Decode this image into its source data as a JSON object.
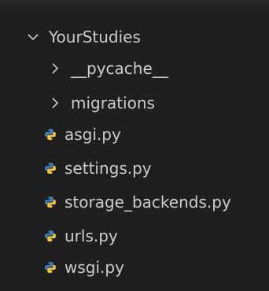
{
  "explorer": {
    "root_folder": {
      "label": "YourStudies",
      "icon": "chevron-down-icon",
      "expanded": true
    },
    "items": [
      {
        "label": "__pycache__",
        "type": "folder",
        "icon": "chevron-right-icon"
      },
      {
        "label": "migrations",
        "type": "folder",
        "icon": "chevron-right-icon"
      },
      {
        "label": "asgi.py",
        "type": "file",
        "icon": "python-file-icon"
      },
      {
        "label": "settings.py",
        "type": "file",
        "icon": "python-file-icon"
      },
      {
        "label": "storage_backends.py",
        "type": "file",
        "icon": "python-file-icon"
      },
      {
        "label": "urls.py",
        "type": "file",
        "icon": "python-file-icon"
      },
      {
        "label": "wsgi.py",
        "type": "file",
        "icon": "python-file-icon"
      }
    ],
    "colors": {
      "background": "#1f1f1f",
      "text": "#cccccc",
      "python_blue": "#3d7fb8",
      "python_yellow": "#f3c53a"
    }
  }
}
